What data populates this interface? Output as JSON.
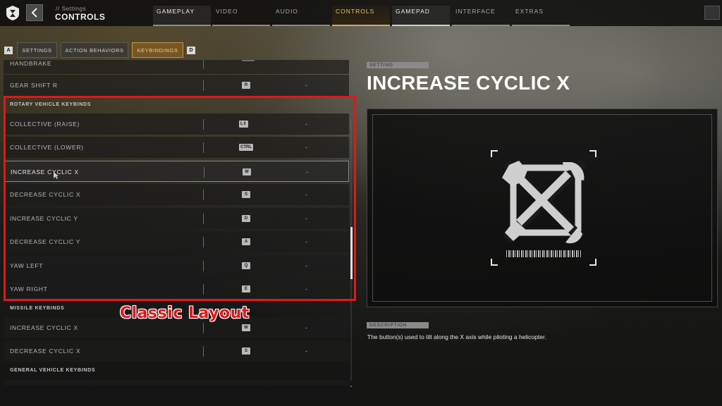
{
  "header": {
    "breadcrumb": "// Settings",
    "title": "CONTROLS",
    "tabs": [
      {
        "label": "GAMEPLAY"
      },
      {
        "label": "VIDEO"
      },
      {
        "label": "AUDIO"
      },
      {
        "label": "CONTROLS"
      },
      {
        "label": "GAMEPAD"
      },
      {
        "label": "INTERFACE"
      },
      {
        "label": "EXTRAS"
      }
    ]
  },
  "subtabs": {
    "left_key": "A",
    "right_key": "D",
    "items": [
      {
        "label": "SETTINGS"
      },
      {
        "label": "ACTION BEHAVIORS"
      },
      {
        "label": "KEYBINDINGS"
      }
    ]
  },
  "list": {
    "rows_top": [
      {
        "label": "HANDBRAKE",
        "key": "",
        "alt": ""
      },
      {
        "label": "GEAR SHIFT R",
        "key": "R",
        "alt": "-"
      }
    ],
    "section_rotary": "ROTARY VEHICLE KEYBINDS",
    "rotary": [
      {
        "label": "COLLECTIVE (RAISE)",
        "key": "L⇧",
        "alt": "-"
      },
      {
        "label": "COLLECTIVE (LOWER)",
        "key": "CTRL",
        "alt": "-"
      },
      {
        "label": "INCREASE CYCLIC X",
        "key": "W",
        "alt": "-"
      },
      {
        "label": "DECREASE CYCLIC X",
        "key": "S",
        "alt": "-"
      },
      {
        "label": "INCREASE CYCLIC Y",
        "key": "D",
        "alt": "-"
      },
      {
        "label": "DECREASE CYCLIC Y",
        "key": "A",
        "alt": "-"
      },
      {
        "label": "YAW LEFT",
        "key": "Q",
        "alt": "-"
      },
      {
        "label": "YAW RIGHT",
        "key": "E",
        "alt": "-"
      }
    ],
    "section_missile": "MISSILE KEYBINDS",
    "missile": [
      {
        "label": "INCREASE CYCLIC X",
        "key": "W",
        "alt": "-"
      },
      {
        "label": "DECREASE CYCLIC X",
        "key": "S",
        "alt": "-"
      }
    ],
    "section_general": "GENERAL VEHICLE KEYBINDS"
  },
  "annotation": "Classic Layout",
  "detail": {
    "setting_label": "SETTING",
    "title": "INCREASE CYCLIC X",
    "description_label": "DESCRIPTION",
    "description": "The button(s) used to tilt along the X axis while piloting a helicopter."
  },
  "colors": {
    "accent": "#d8a65a",
    "annotation": "#e01818"
  }
}
